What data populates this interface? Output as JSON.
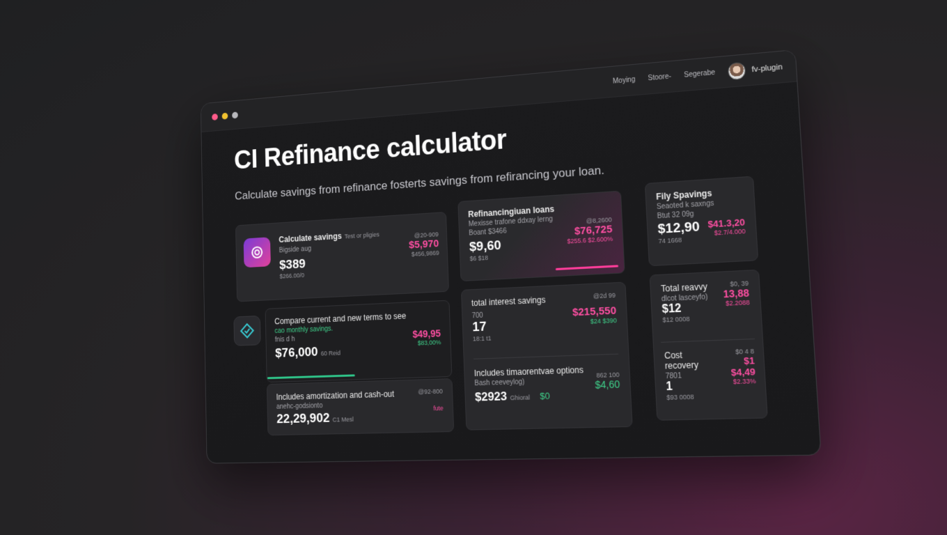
{
  "window": {
    "dots": [
      "#ff5b8a",
      "#f2c230",
      "#b9b9bd"
    ],
    "nav": [
      "Moying",
      "Stoore-",
      "Segerabe"
    ],
    "user": "fv-plugin"
  },
  "hero": {
    "title": "CI Refinance calculator",
    "subtitle": "Calculate savings from refinance fosterts savings from refirancing your loan."
  },
  "cards": {
    "savings": {
      "label": "Calculate savings",
      "tag": "Test or pligies",
      "sub": "Bigside aug",
      "value": "$389",
      "foot": "$266.00/0",
      "r1": "@20-909",
      "r2": "$5,970",
      "r3": "$456,9869"
    },
    "refi": {
      "label": "Refinancingiuan loans",
      "sub1": "Mexisse trafone ddxay lerng",
      "sub2": "Boant $3466",
      "value": "$9,60",
      "foot": "$6 $18",
      "r1": "@8,2600",
      "r2": "$76,725",
      "r3": "$255.6 $2.600%"
    },
    "fily": {
      "label": "Fily Spavings",
      "sub1": "Seaoted k saxngs",
      "sub2": "Btut 32 09g",
      "value": "$12,90",
      "foot": "74 1668",
      "r1": "$41.3,20",
      "r2": "$2.7/4.000"
    },
    "compare": {
      "label": "Compare current and new terms to see",
      "sub1": "cao monthly savings.",
      "sub2": "fnis d h",
      "value": "$76,000",
      "tag": "60 Reid",
      "r1": "$49,95",
      "r2": "$83,00%"
    },
    "amort": {
      "label": "Includes amortization and cash-out",
      "sub": "anehc-godsionto",
      "value": "22,29,902",
      "tag": "C1 Mesl",
      "r1": "@92-800",
      "r2": "fute"
    },
    "interest": {
      "label": "total interest savings",
      "sub": "700",
      "value": "17",
      "foot": "18:1 t1",
      "r1": "@2d 99",
      "r2": "$215,550",
      "r3": "$24 $390"
    },
    "includes": {
      "label": "Includes timaorentvae options",
      "sub": "Bash ceeveylog)",
      "value": "$2923",
      "tag": "Ghioral",
      "mid": "$0",
      "r1": "862 100",
      "r2": "$4,60"
    },
    "total": {
      "label": "Total reavvy",
      "sub": "dlcot lasceyfo)",
      "value": "$12",
      "foot": "$12 0008",
      "r1": "$0, 39",
      "r2": "13,88",
      "r3": "$2.2088"
    },
    "cost": {
      "label": "Cost recovery",
      "sub": "7801",
      "value": "1",
      "foot": "$93 0008",
      "r1": "$1 $4,49",
      "r1a": "$0 4 8",
      "r2": "$2.33%"
    }
  },
  "colors": {
    "accent": "#ff4fa3",
    "positive": "#3fd08a"
  },
  "icons": [
    "gear-gradient-icon",
    "diamond-check-icon"
  ]
}
